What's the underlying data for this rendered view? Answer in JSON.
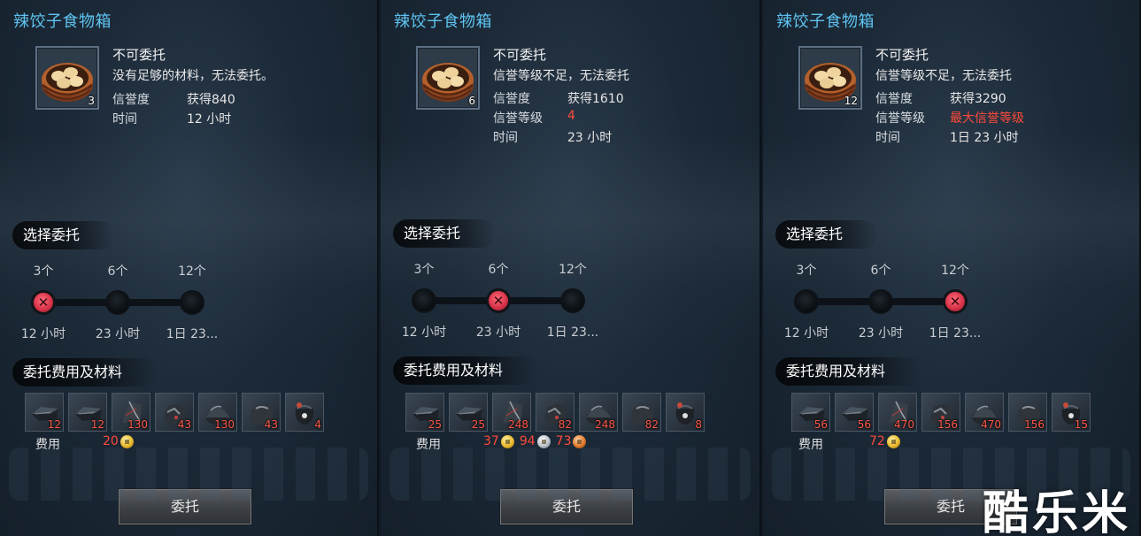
{
  "colors": {
    "title": "#5fc3f0",
    "warning_red": "#ff4a3a",
    "background": "#1c2a38"
  },
  "panels": [
    {
      "title": "辣饺子食物箱",
      "item_icon": "dumpling-steamer-icon",
      "item_count": "3",
      "status_title": "不可委托",
      "status_reason": "没有足够的材料，无法委托。",
      "rows": [
        {
          "label": "信誉度",
          "value": "获得840",
          "highlight": false
        },
        {
          "label": "时间",
          "value": "12 小时",
          "highlight": false
        }
      ],
      "section_select": "选择委托",
      "steps": [
        "3个",
        "6个",
        "12个"
      ],
      "selected_step": 0,
      "times": [
        "12 小时",
        "23 小时",
        "1日 23..."
      ],
      "section_cost": "委托费用及材料",
      "materials": [
        "12",
        "12",
        "130",
        "43",
        "130",
        "43",
        "4"
      ],
      "fee_label": "费用",
      "fees": [
        {
          "amount": "20",
          "coin": "gold"
        }
      ],
      "confirm_label": "委托"
    },
    {
      "title": "辣饺子食物箱",
      "item_icon": "dumpling-steamer-icon",
      "item_count": "6",
      "status_title": "不可委托",
      "status_reason": "信誉等级不足，无法委托",
      "rows": [
        {
          "label": "信誉度",
          "value": "获得1610",
          "highlight": false
        },
        {
          "label": "信誉等级",
          "value": "4",
          "highlight": true
        },
        {
          "label": "时间",
          "value": "23 小时",
          "highlight": false
        }
      ],
      "section_select": "选择委托",
      "steps": [
        "3个",
        "6个",
        "12个"
      ],
      "selected_step": 1,
      "times": [
        "12 小时",
        "23 小时",
        "1日 23..."
      ],
      "section_cost": "委托费用及材料",
      "materials": [
        "25",
        "25",
        "248",
        "82",
        "248",
        "82",
        "8"
      ],
      "fee_label": "费用",
      "fees": [
        {
          "amount": "37",
          "coin": "gold"
        },
        {
          "amount": "94",
          "coin": "silver"
        },
        {
          "amount": "73",
          "coin": "copper"
        }
      ],
      "confirm_label": "委托"
    },
    {
      "title": "辣饺子食物箱",
      "item_icon": "dumpling-steamer-icon",
      "item_count": "12",
      "status_title": "不可委托",
      "status_reason": "信誉等级不足，无法委托",
      "rows": [
        {
          "label": "信誉度",
          "value": "获得3290",
          "highlight": false
        },
        {
          "label": "信誉等级",
          "value": "最大信誉等级",
          "highlight": true
        },
        {
          "label": "时间",
          "value": "1日 23 小时",
          "highlight": false
        }
      ],
      "section_select": "选择委托",
      "steps": [
        "3个",
        "6个",
        "12个"
      ],
      "selected_step": 2,
      "times": [
        "12 小时",
        "23 小时",
        "1日 23..."
      ],
      "section_cost": "委托费用及材料",
      "materials": [
        "56",
        "56",
        "470",
        "156",
        "470",
        "156",
        "15"
      ],
      "fee_label": "费用",
      "fees": [
        {
          "amount": "72",
          "coin": "gold"
        }
      ],
      "confirm_label": "委托"
    }
  ],
  "material_icons": [
    "iron-ingot-icon",
    "iron-ingot-icon",
    "crystal-shard-icon",
    "ore-chunk-icon",
    "metal-dome-icon",
    "ore-lump-icon",
    "pouch-icon"
  ],
  "watermark": "酷乐米"
}
